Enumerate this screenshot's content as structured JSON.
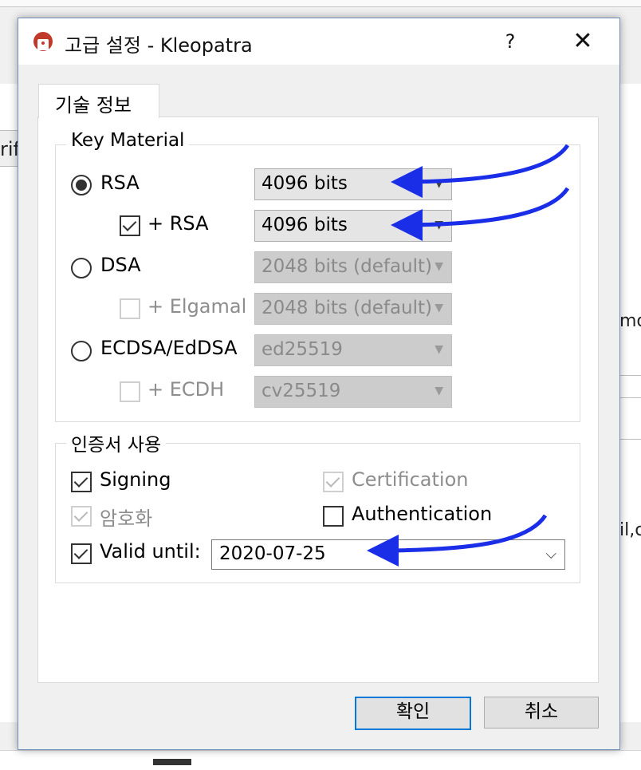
{
  "window": {
    "title": "고급 설정 - Kleopatra",
    "help_label": "?",
    "close_label": "✕"
  },
  "tab": {
    "label": "기술 정보"
  },
  "key_material": {
    "title": "Key Material",
    "rsa": {
      "label": "RSA",
      "selected": true,
      "value": "4096 bits"
    },
    "rsa_sub": {
      "label": "+ RSA",
      "checked": true,
      "value": "4096 bits"
    },
    "dsa": {
      "label": "DSA",
      "selected": false,
      "value": "2048 bits (default)"
    },
    "elgamal": {
      "label": "+ Elgamal",
      "checked": false,
      "value": "2048 bits (default)"
    },
    "ecdsa": {
      "label": "ECDSA/EdDSA",
      "selected": false,
      "value": "ed25519"
    },
    "ecdh": {
      "label": "+ ECDH",
      "checked": false,
      "value": "cv25519"
    }
  },
  "usage": {
    "title": "인증서 사용",
    "signing": {
      "label": "Signing",
      "checked": true
    },
    "certification": {
      "label": "Certification",
      "checked": true,
      "disabled": true
    },
    "encryption": {
      "label": "암호화",
      "checked": true,
      "disabled": true
    },
    "authentication": {
      "label": "Authentication",
      "checked": false
    },
    "valid_until": {
      "label": "Valid until:",
      "checked": true,
      "value": "2020-07-25"
    }
  },
  "buttons": {
    "ok": "확인",
    "cancel": "취소"
  },
  "background_fragments": {
    "left": "rify",
    "right_top": "mo",
    "right_mid": "il,c"
  },
  "colors": {
    "annotation_arrow": "#1a2ee8",
    "focus_border": "#0078d7"
  }
}
